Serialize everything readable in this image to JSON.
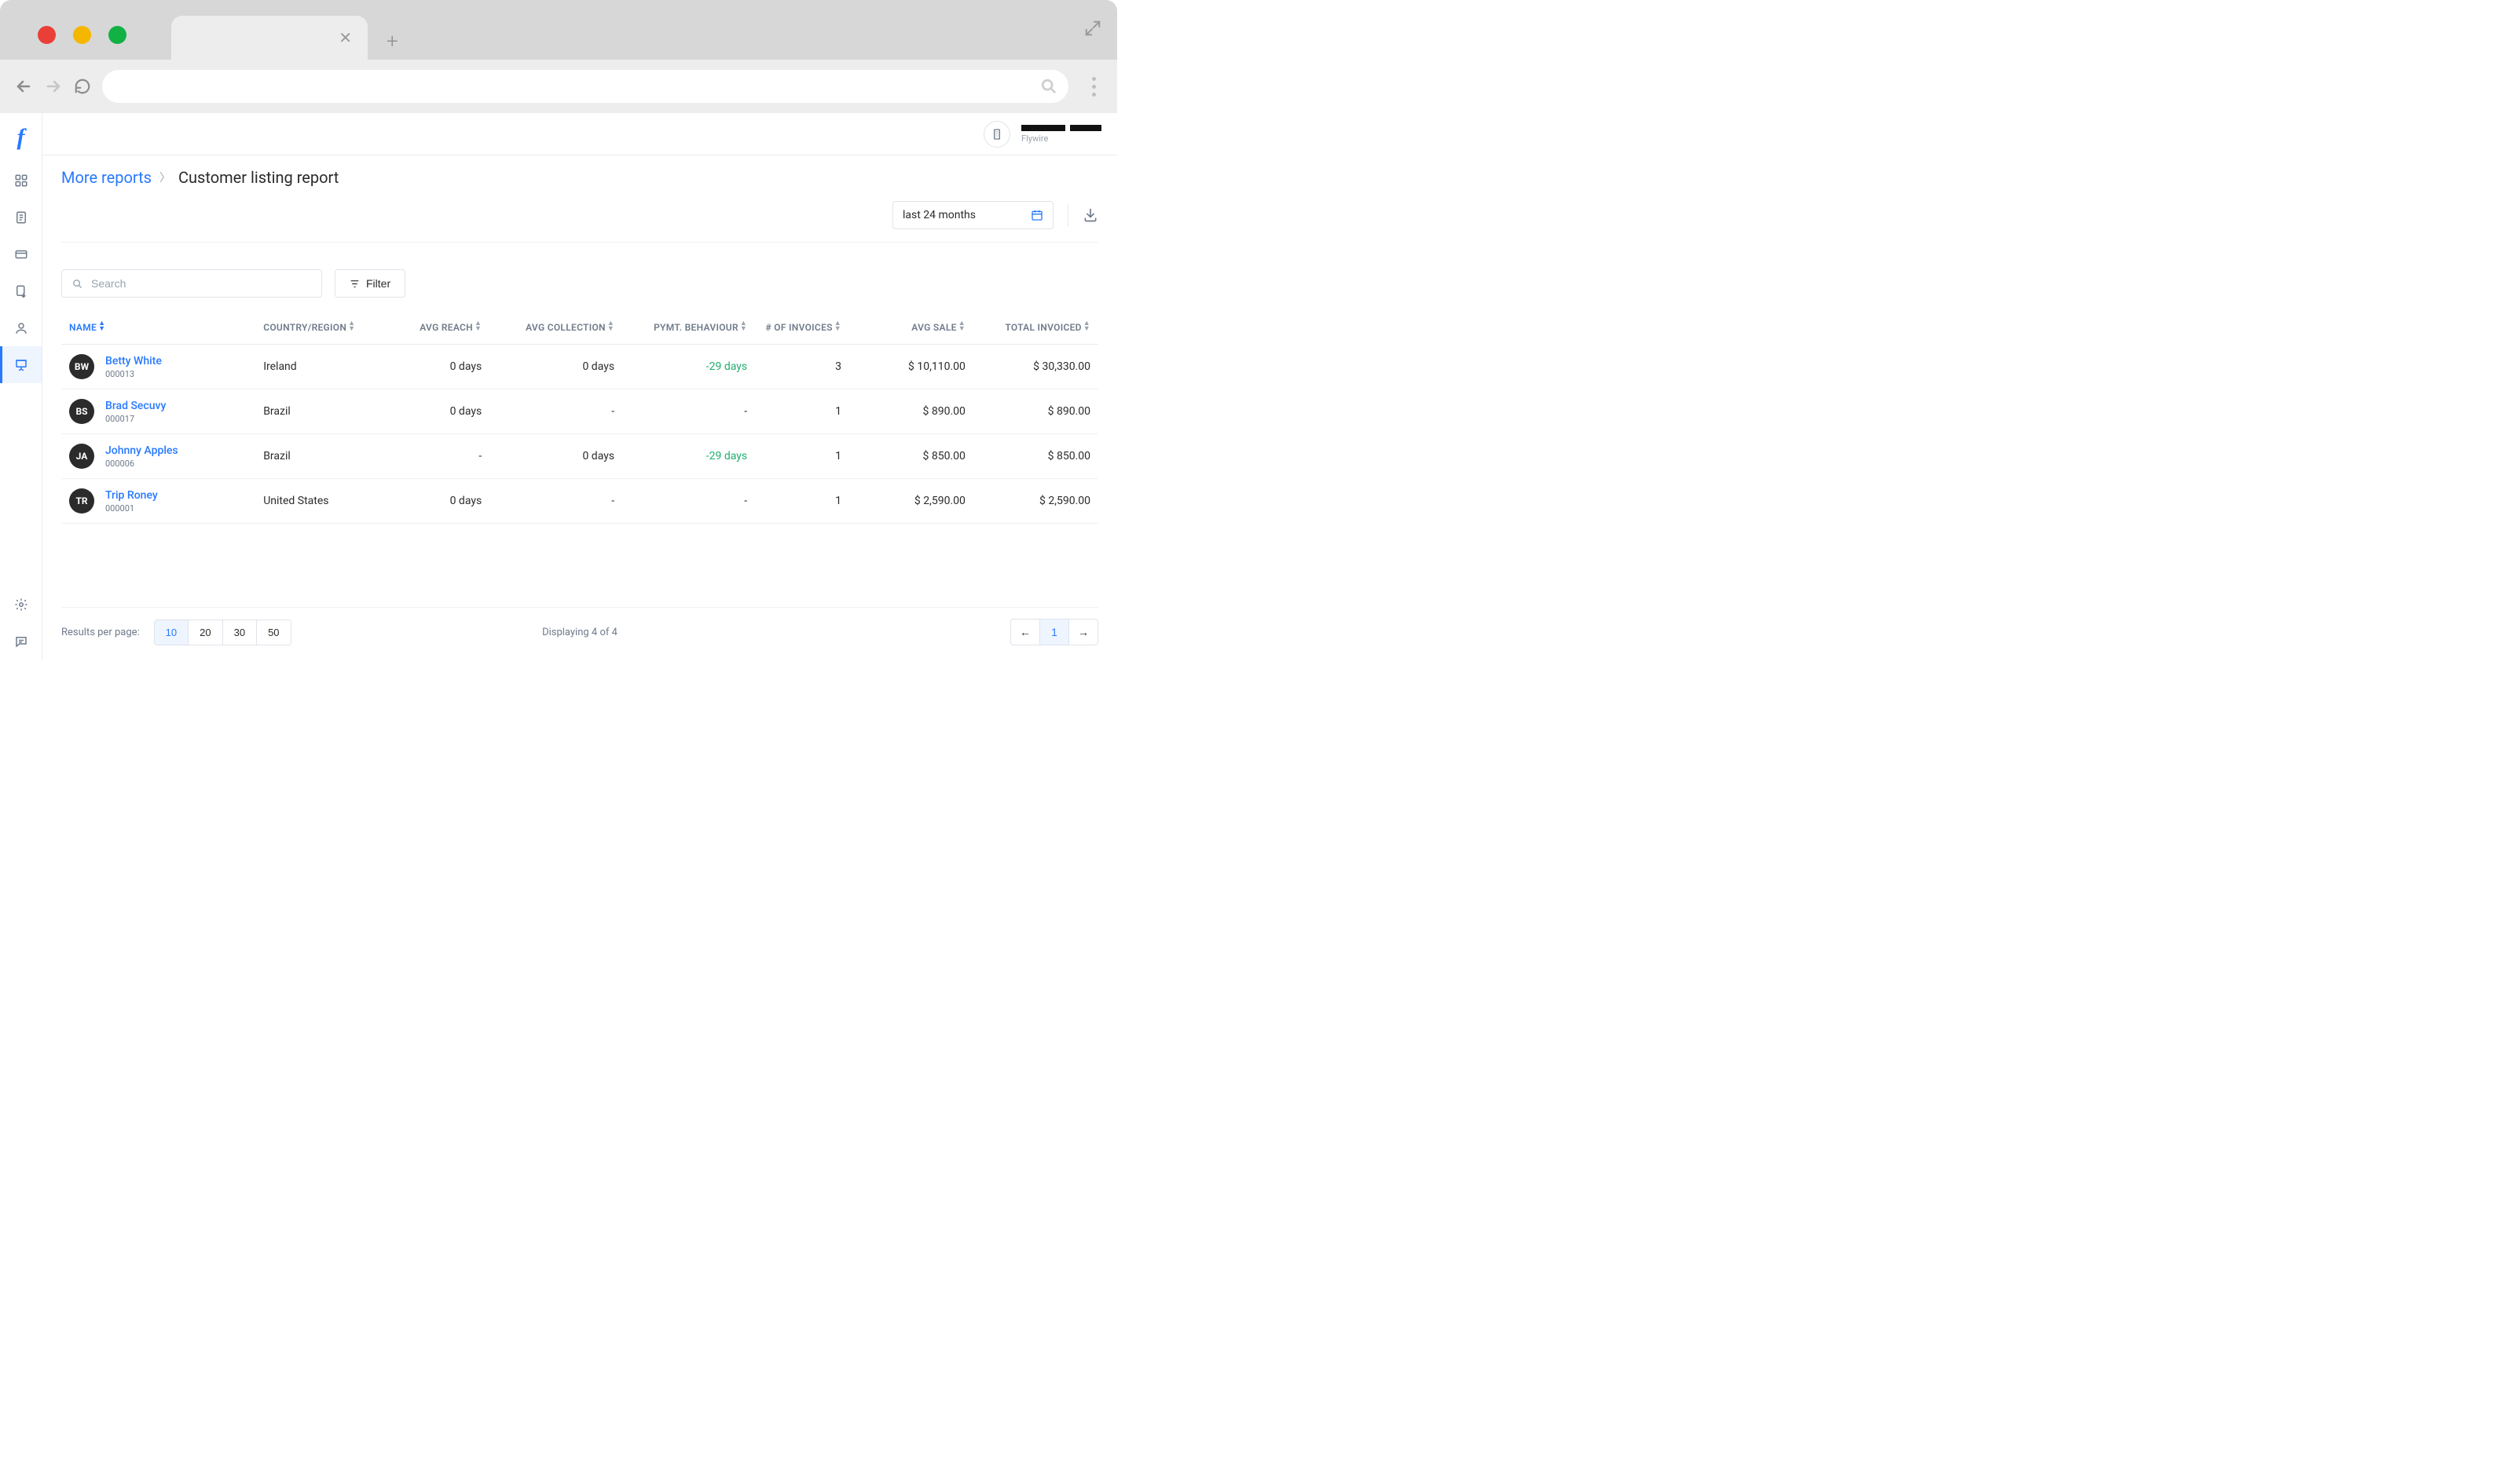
{
  "org": {
    "label": "Flywire"
  },
  "breadcrumb": {
    "parent": "More reports",
    "current": "Customer listing report"
  },
  "date_range": {
    "label": "last 24 months"
  },
  "search": {
    "placeholder": "Search"
  },
  "filter": {
    "label": "Filter"
  },
  "columns": {
    "name": "NAME",
    "country": "COUNTRY/REGION",
    "avg_reach": "AVG REACH",
    "avg_collection": "AVG COLLECTION",
    "pymt_behaviour": "PYMT. BEHAVIOUR",
    "num_invoices": "# OF INVOICES",
    "avg_sale": "AVG SALE",
    "total_invoiced": "TOTAL INVOICED"
  },
  "rows": [
    {
      "initials": "BW",
      "name": "Betty White",
      "id": "000013",
      "country": "Ireland",
      "avg_reach": "0 days",
      "avg_collection": "0 days",
      "pymt": "-29 days",
      "pymt_positive": true,
      "num_invoices": "3",
      "avg_sale": "$ 10,110.00",
      "total": "$ 30,330.00"
    },
    {
      "initials": "BS",
      "name": "Brad Secuvy",
      "id": "000017",
      "country": "Brazil",
      "avg_reach": "0 days",
      "avg_collection": "-",
      "pymt": "-",
      "pymt_positive": false,
      "num_invoices": "1",
      "avg_sale": "$ 890.00",
      "total": "$ 890.00"
    },
    {
      "initials": "JA",
      "name": "Johnny Apples",
      "id": "000006",
      "country": "Brazil",
      "avg_reach": "-",
      "avg_collection": "0 days",
      "pymt": "-29 days",
      "pymt_positive": true,
      "num_invoices": "1",
      "avg_sale": "$ 850.00",
      "total": "$ 850.00"
    },
    {
      "initials": "TR",
      "name": "Trip Roney",
      "id": "000001",
      "country": "United States",
      "avg_reach": "0 days",
      "avg_collection": "-",
      "pymt": "-",
      "pymt_positive": false,
      "num_invoices": "1",
      "avg_sale": "$ 2,590.00",
      "total": "$ 2,590.00"
    }
  ],
  "footer": {
    "rpp_label": "Results per page:",
    "options": [
      "10",
      "20",
      "30",
      "50"
    ],
    "active_option": "10",
    "displaying": "Displaying 4 of 4",
    "current_page": "1"
  }
}
